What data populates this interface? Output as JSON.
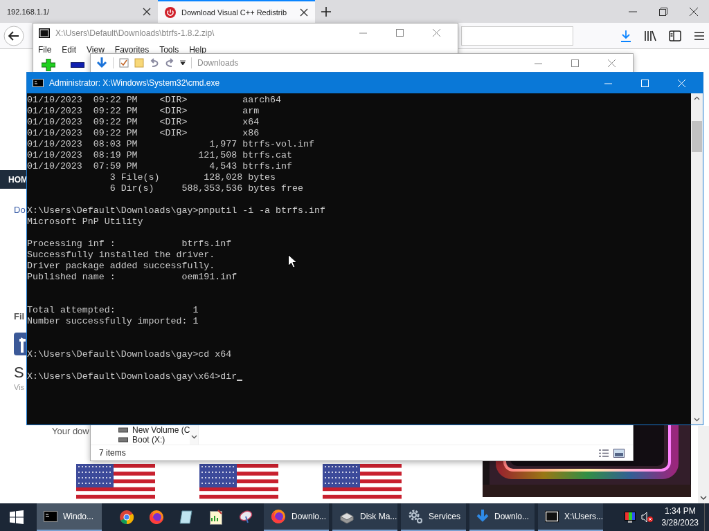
{
  "browser": {
    "tabs": [
      {
        "label": "192.168.1.1/",
        "selected": false
      },
      {
        "label": "Download Visual C++ Redistrib",
        "selected": true
      }
    ],
    "page": {
      "nav_label": "HOM",
      "link": "Do",
      "heading": "Fil",
      "title": "S",
      "subtitle": "Vis",
      "note": "Your dow"
    }
  },
  "zip_window": {
    "title": "X:\\Users\\Default\\Downloads\\btrfs-1.8.2.zip\\",
    "menu": [
      "File",
      "Edit",
      "View",
      "Favorites",
      "Tools",
      "Help"
    ]
  },
  "explorer": {
    "title": "Downloads",
    "drives": [
      "New Volume (C",
      "Boot (X:)"
    ],
    "status": "7 items"
  },
  "cmd": {
    "title": "Administrator: X:\\Windows\\System32\\cmd.exe",
    "lines": [
      {
        "kind": "text",
        "text": "01/10/2023  09:22 PM    <DIR>          aarch64"
      },
      {
        "kind": "text",
        "text": "01/10/2023  09:22 PM    <DIR>          arm"
      },
      {
        "kind": "text",
        "text": "01/10/2023  09:22 PM    <DIR>          x64"
      },
      {
        "kind": "text",
        "text": "01/10/2023  09:22 PM    <DIR>          x86"
      },
      {
        "kind": "text",
        "text": "01/10/2023  08:03 PM             1,977 btrfs-vol.inf"
      },
      {
        "kind": "text",
        "text": "01/10/2023  08:19 PM           121,508 btrfs.cat"
      },
      {
        "kind": "text",
        "text": "01/10/2023  07:59 PM             4,543 btrfs.inf"
      },
      {
        "kind": "text",
        "text": "               3 File(s)        128,028 bytes"
      },
      {
        "kind": "text",
        "text": "               6 Dir(s)     588,353,536 bytes free"
      },
      {
        "kind": "blank"
      },
      {
        "kind": "text",
        "text": "X:\\Users\\Default\\Downloads\\gay>pnputil -i -a btrfs.inf"
      },
      {
        "kind": "text",
        "text": "Microsoft PnP Utility"
      },
      {
        "kind": "blank"
      },
      {
        "kind": "text",
        "text": "Processing inf :            btrfs.inf"
      },
      {
        "kind": "text",
        "text": "Successfully installed the driver."
      },
      {
        "kind": "text",
        "text": "Driver package added successfully."
      },
      {
        "kind": "text",
        "text": "Published name :            oem191.inf"
      },
      {
        "kind": "blank"
      },
      {
        "kind": "blank"
      },
      {
        "kind": "text",
        "text": "Total attempted:              1"
      },
      {
        "kind": "text",
        "text": "Number successfully imported: 1"
      },
      {
        "kind": "blank"
      },
      {
        "kind": "blank"
      },
      {
        "kind": "text",
        "text": "X:\\Users\\Default\\Downloads\\gay>cd x64"
      },
      {
        "kind": "blank"
      },
      {
        "kind": "prompt",
        "text": "X:\\Users\\Default\\Downloads\\gay\\x64>dir"
      }
    ]
  },
  "taskbar": {
    "items": [
      {
        "kind": "cmd",
        "label": "Windo...",
        "selected": true
      },
      {
        "kind": "chrome",
        "selected": false
      },
      {
        "kind": "firefox",
        "selected": false
      },
      {
        "kind": "notepad",
        "selected": false
      },
      {
        "kind": "sheet",
        "selected": false
      },
      {
        "kind": "satellite",
        "selected": false
      },
      {
        "kind": "firefox",
        "label": "Downlo...",
        "selected": false
      },
      {
        "kind": "disk",
        "label": "Disk Ma...",
        "selected": false
      },
      {
        "kind": "gear",
        "label": "Services",
        "selected": false
      },
      {
        "kind": "download",
        "label": "Downlo...",
        "selected": false
      },
      {
        "kind": "archive",
        "label": "X:\\Users...",
        "selected": false
      }
    ],
    "time": "1:34 PM",
    "date": "3/28/2023"
  }
}
